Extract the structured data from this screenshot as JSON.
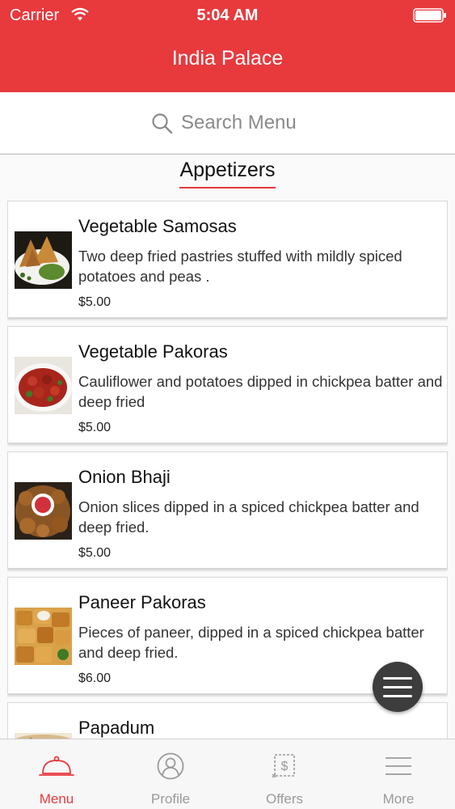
{
  "status_bar": {
    "carrier": "Carrier",
    "time": "5:04 AM"
  },
  "header": {
    "title": "India Palace"
  },
  "search": {
    "placeholder": "Search Menu"
  },
  "section": {
    "title": "Appetizers"
  },
  "items": [
    {
      "name": "Vegetable Samosas",
      "description": "Two deep fried pastries stuffed with mildly spiced potatoes and peas .",
      "price": "$5.00"
    },
    {
      "name": "Vegetable Pakoras",
      "description": "Cauliflower and potatoes dipped in chickpea batter and deep fried",
      "price": "$5.00"
    },
    {
      "name": "Onion Bhaji",
      "description": "Onion slices dipped in a spiced chickpea batter and deep fried.",
      "price": "$5.00"
    },
    {
      "name": "Paneer Pakoras",
      "description": " Pieces of paneer, dipped in a spiced chickpea batter and deep fried.",
      "price": "$6.00"
    },
    {
      "name": "Papadum",
      "description": "",
      "price": ""
    }
  ],
  "tabs": [
    {
      "label": "Menu",
      "icon": "cloche-icon",
      "active": true
    },
    {
      "label": "Profile",
      "icon": "profile-icon",
      "active": false
    },
    {
      "label": "Offers",
      "icon": "offers-icon",
      "active": false
    },
    {
      "label": "More",
      "icon": "more-icon",
      "active": false
    }
  ],
  "colors": {
    "accent": "#e8393d",
    "fab": "#3d3d3d",
    "tab_inactive": "#9a9a9a"
  }
}
